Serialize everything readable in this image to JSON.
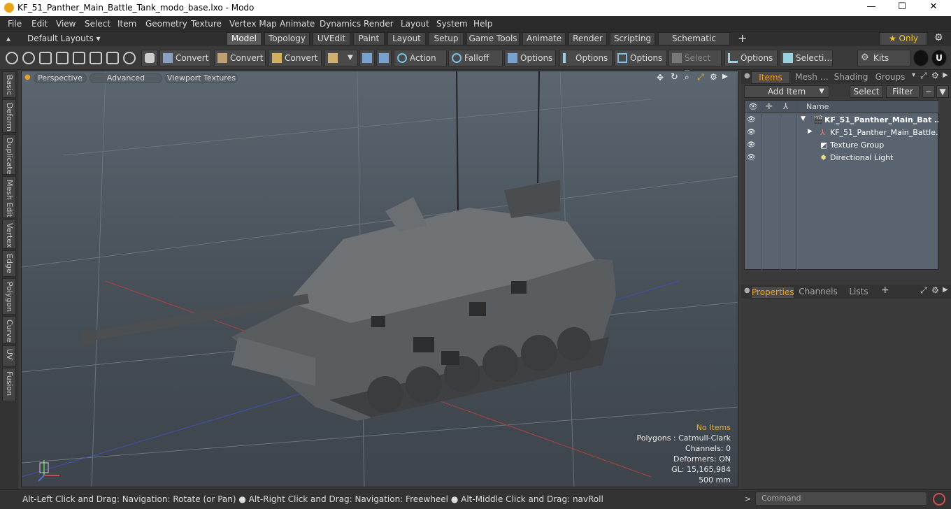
{
  "window": {
    "title": "KF_51_Panther_Main_Battle_Tank_modo_base.lxo - Modo",
    "minimize": "—",
    "maximize": "☐",
    "close": "✕"
  },
  "menu": [
    "File",
    "Edit",
    "View",
    "Select",
    "Item",
    "Geometry",
    "Texture",
    "Vertex Map",
    "Animate",
    "Dynamics",
    "Render",
    "Layout",
    "System",
    "Help"
  ],
  "layouts": {
    "label": "Default Layouts ▾"
  },
  "tabs": [
    "Model",
    "Topology",
    "UVEdit",
    "Paint",
    "Layout",
    "Setup",
    "Game Tools",
    "Animate",
    "Render",
    "Scripting",
    "Schematic Fusion"
  ],
  "tabs_active": "Model",
  "only": {
    "label": "★ Only"
  },
  "toolbar": {
    "convert1": "Convert",
    "convert2": "Convert",
    "convert3": "Convert",
    "action": "Action …",
    "falloff": "Falloff",
    "options1": "Options",
    "options2": "Options",
    "options3": "Options",
    "select_t": "Select T…",
    "options4": "Options",
    "selecti": "Selecti…",
    "kits": "Kits"
  },
  "left_tabs": [
    "Basic",
    "Deform",
    "Duplicate",
    "Mesh Edit",
    "Vertex",
    "Edge",
    "Polygon",
    "Curve",
    "UV",
    "Fusion"
  ],
  "viewport": {
    "perspective": "Perspective",
    "advanced": "Advanced",
    "textures": "Viewport Textures",
    "stats": {
      "no_items": "No Items",
      "polygons": "Polygons : Catmull-Clark",
      "channels": "Channels: 0",
      "deformers": "Deformers: ON",
      "gl": "GL: 15,165,984",
      "scale": "500 mm"
    }
  },
  "items_panel": {
    "tabs": [
      "Items",
      "Mesh …",
      "Shading",
      "Groups"
    ],
    "add_item": "Add Item",
    "select": "Select",
    "filter": "Filter",
    "name_col": "Name",
    "rows": [
      "KF_51_Panther_Main_Bat …",
      "KF_51_Panther_Main_Battle…",
      "Texture Group",
      "Directional Light"
    ]
  },
  "props_panel": {
    "tabs": [
      "Properties",
      "Channels",
      "Lists"
    ]
  },
  "status": {
    "text": "Alt-Left Click and Drag: Navigation: Rotate (or Pan) ● Alt-Right Click and Drag: Navigation: Freewheel ● Alt-Middle Click and Drag: navRoll",
    "command_placeholder": "Command"
  },
  "colors": {
    "accent": "#f0a020",
    "viewport_top": "#5b6670"
  }
}
